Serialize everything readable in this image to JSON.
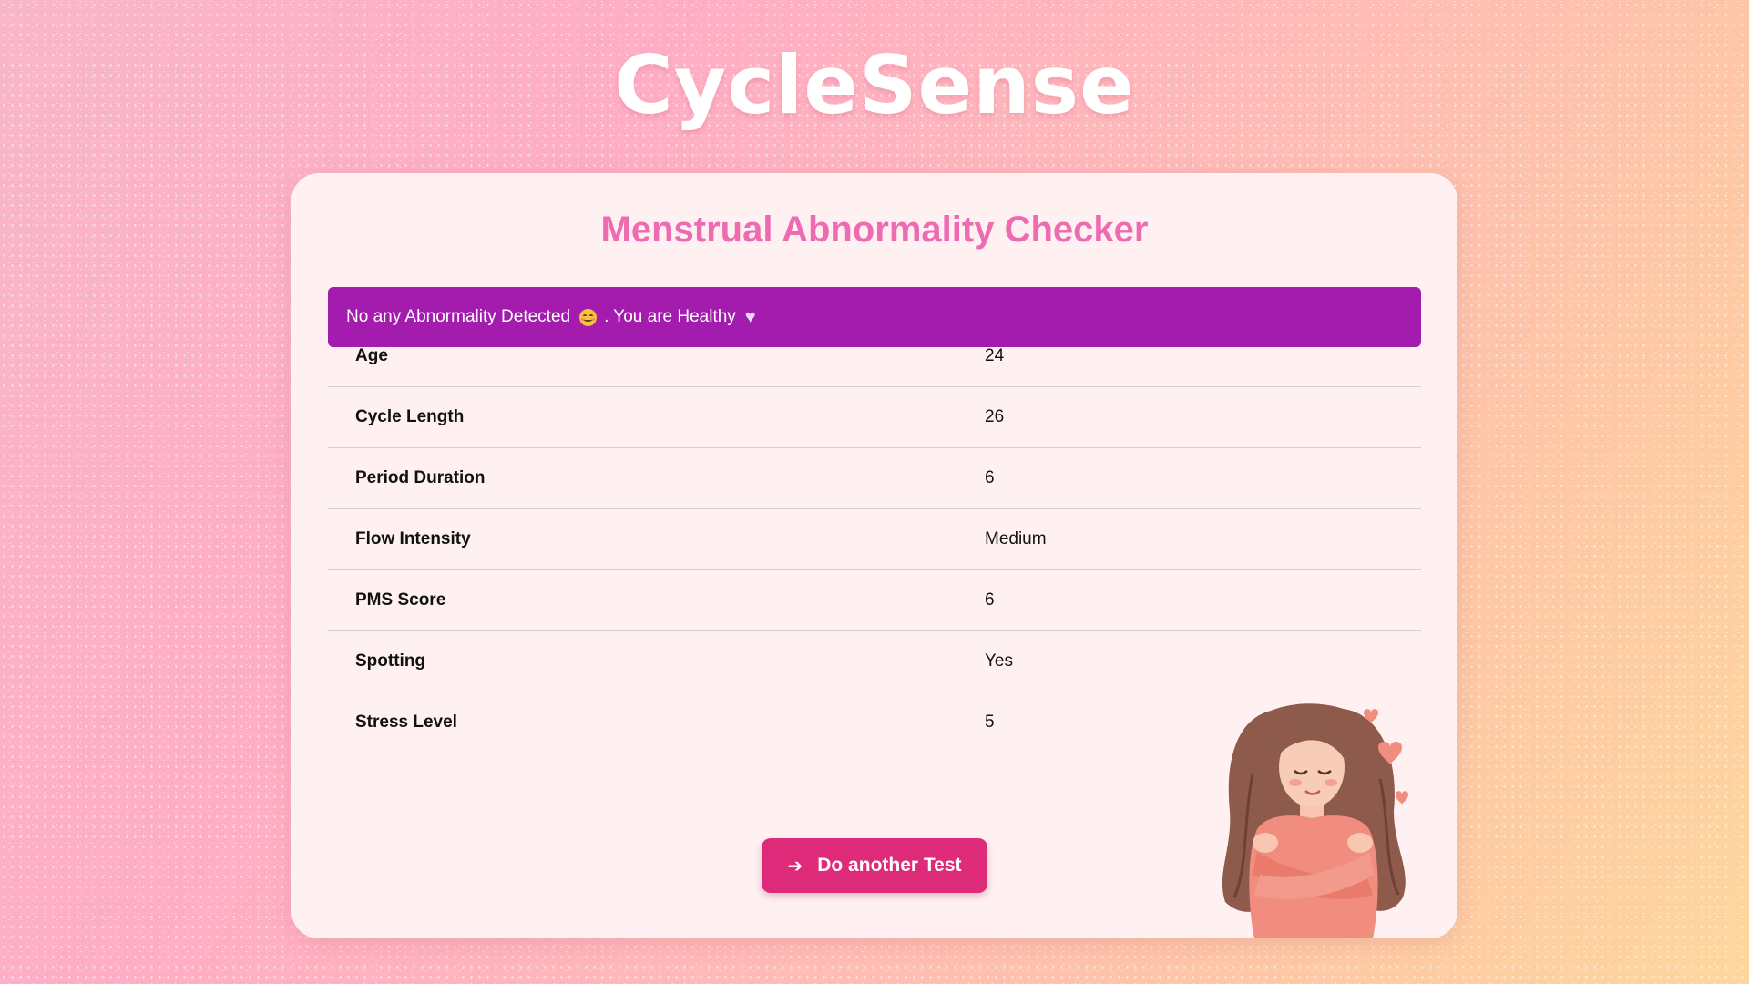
{
  "app": {
    "title": "CycleSense"
  },
  "card": {
    "title": "Menstrual Abnormality Checker",
    "alert": {
      "text_before": "No any Abnormality Detected",
      "text_after": ". You are Healthy"
    },
    "results": [
      {
        "label": "Age",
        "value": "24"
      },
      {
        "label": "Cycle Length",
        "value": "26"
      },
      {
        "label": "Period Duration",
        "value": "6"
      },
      {
        "label": "Flow Intensity",
        "value": "Medium"
      },
      {
        "label": "PMS Score",
        "value": "6"
      },
      {
        "label": "Spotting",
        "value": "Yes"
      },
      {
        "label": "Stress Level",
        "value": "5"
      }
    ],
    "button": {
      "label": "Do another Test",
      "icon": "arrow-right-icon"
    }
  },
  "colors": {
    "title": "#ef6bb1",
    "alert_bg": "#a31cae",
    "button_bg": "#dd2a79",
    "card_bg": "#fff1f2"
  },
  "illustration": {
    "name": "self-hug-woman-illustration"
  }
}
